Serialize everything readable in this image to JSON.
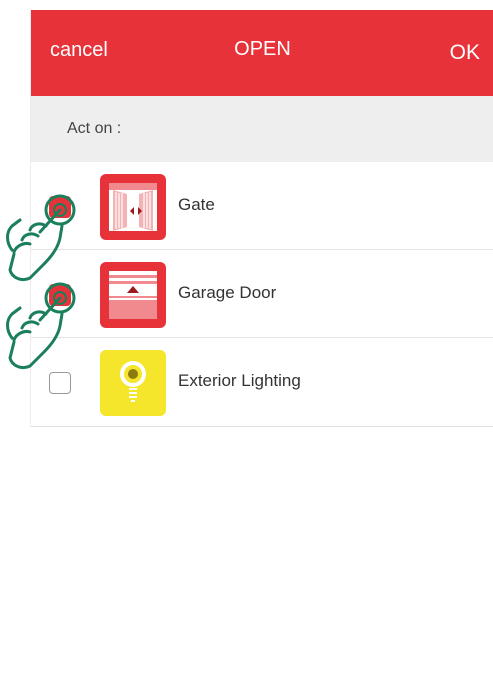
{
  "header": {
    "cancel_label": "cancel",
    "title": "OPEN",
    "ok_label": "OK"
  },
  "section": {
    "label": "Act on :"
  },
  "devices": [
    {
      "label": "Gate",
      "checked": true,
      "icon": "gate-icon"
    },
    {
      "label": "Garage Door",
      "checked": true,
      "icon": "garage-door-icon"
    },
    {
      "label": "Exterior Lighting",
      "checked": false,
      "icon": "exterior-lighting-icon"
    }
  ],
  "colors": {
    "accent": "#e8323a",
    "lighting_tile": "#f5e52b",
    "tap_hint": "#1a7f5a"
  }
}
